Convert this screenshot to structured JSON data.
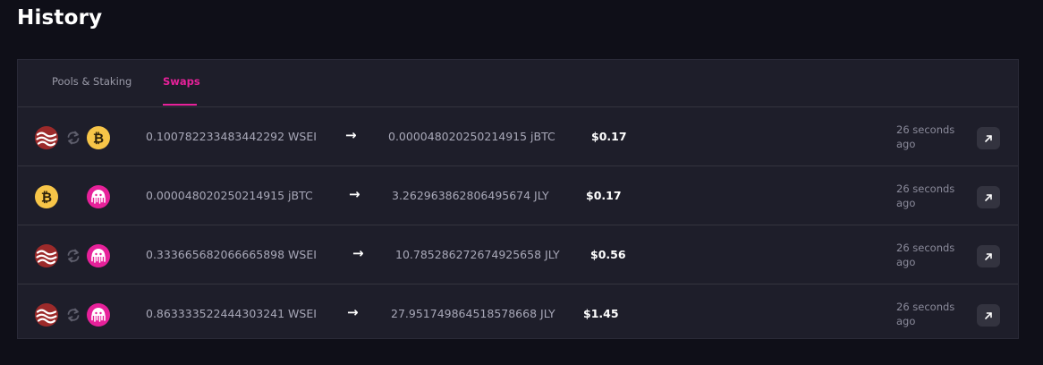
{
  "page": {
    "title": "History"
  },
  "tabs": [
    {
      "label": "Pools & Staking",
      "active": false
    },
    {
      "label": "Swaps",
      "active": true
    }
  ],
  "colors": {
    "background": "#0f0f18",
    "panel": "#1e1e2a",
    "accent": "#e7219a",
    "sei": "#9c2a2a",
    "btc": "#f7c548",
    "jly": "#e7219a"
  },
  "swaps": [
    {
      "from_icon": "sei-token-icon",
      "to_icon": "btc-token-icon",
      "from_amount": "0.100782233483442292 WSEI",
      "arrow": "→",
      "to_amount": "0.000048020250214915 jBTC",
      "usd": "$0.17",
      "time": "26 seconds ago"
    },
    {
      "from_icon": "btc-token-icon",
      "to_icon": "jelly-token-icon",
      "from_amount": "0.000048020250214915 jBTC",
      "arrow": "→",
      "to_amount": "3.262963862806495674 JLY",
      "usd": "$0.17",
      "time": "26 seconds ago"
    },
    {
      "from_icon": "sei-token-icon",
      "to_icon": "jelly-token-icon",
      "from_amount": "0.333665682066665898 WSEI",
      "arrow": "→",
      "to_amount": "10.785286272674925658 JLY",
      "usd": "$0.56",
      "time": "26 seconds ago"
    },
    {
      "from_icon": "sei-token-icon",
      "to_icon": "jelly-token-icon",
      "from_amount": "0.863333522444303241 WSEI",
      "arrow": "→",
      "to_amount": "27.951749864518578668 JLY",
      "usd": "$1.45",
      "time": "26 seconds ago"
    }
  ]
}
